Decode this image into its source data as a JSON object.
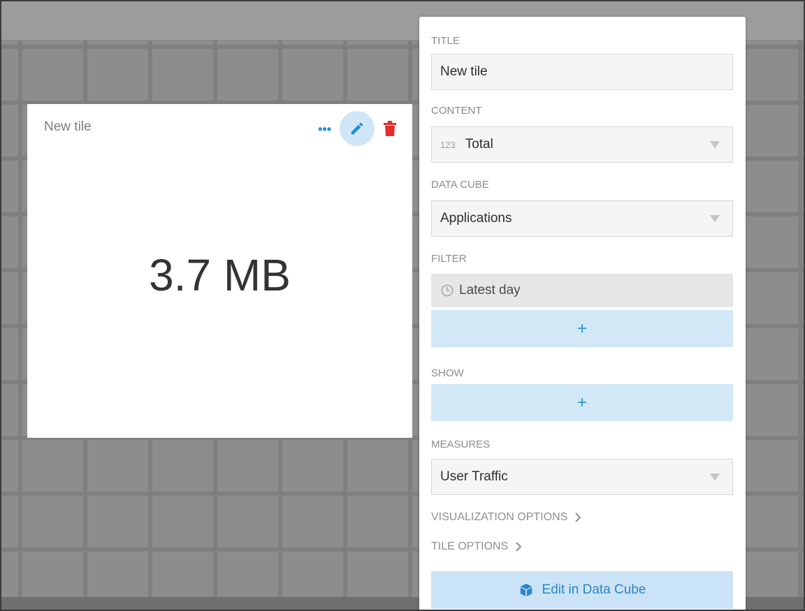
{
  "tile": {
    "title": "New tile",
    "value": "3.7 MB",
    "icons": [
      "more-dots-icon",
      "pencil-icon",
      "trash-icon"
    ]
  },
  "panel": {
    "title_label": "TITLE",
    "title_value": "New tile",
    "content_label": "CONTENT",
    "content_tag": "123",
    "content_value": "Total",
    "datacube_label": "DATA CUBE",
    "datacube_value": "Applications",
    "filter_label": "FILTER",
    "filter_chip": "Latest day",
    "filter_add": "+",
    "show_label": "SHOW",
    "show_add": "+",
    "measures_label": "MEASURES",
    "measures_value": "User Traffic",
    "visualization_options": "VISUALIZATION OPTIONS",
    "tile_options": "TILE OPTIONS",
    "edit_button": "Edit in Data Cube"
  },
  "colors": {
    "accent": "#2b95d8",
    "delete": "#e0302b",
    "button_bg": "#d2e8f7"
  }
}
